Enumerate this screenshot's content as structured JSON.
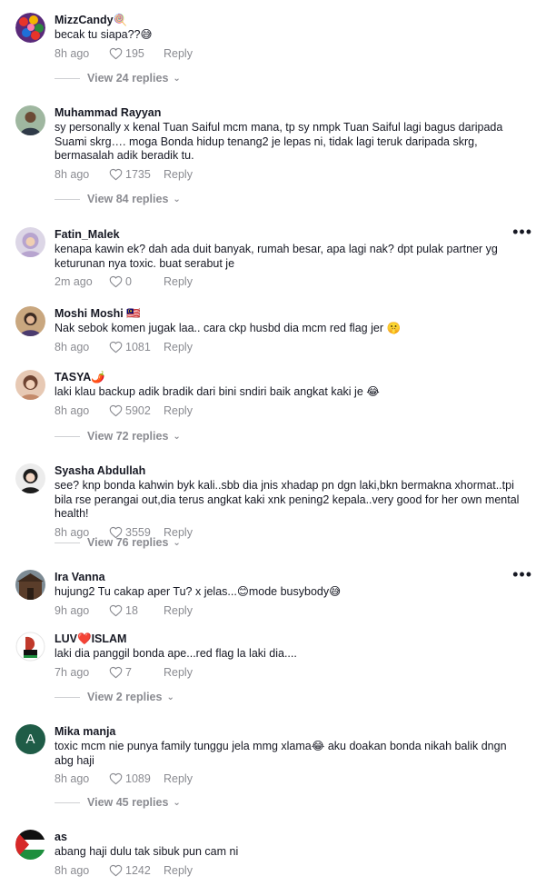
{
  "actions": {
    "view_prefix": "View",
    "view_suffix": "replies",
    "dots": "•••"
  },
  "comments": [
    {
      "username": "MizzCandy",
      "user_emoji": "🍭",
      "text": "becak tu siapa??😅",
      "time": "8h ago",
      "likes": "195",
      "reply": "Reply",
      "replies_label": "View 24 replies",
      "avatar": "candy-avatar"
    },
    {
      "username": "Muhammad Rayyan",
      "user_emoji": "",
      "text": "sy personally x kenal Tuan Saiful mcm mana, tp sy nmpk Tuan Saiful lagi bagus daripada Suami skrg…. moga Bonda hidup tenang2 je lepas ni, tidak lagi teruk daripada skrg, bermasalah adik beradik tu.",
      "time": "8h ago",
      "likes": "1735",
      "reply": "Reply",
      "replies_label": "View 84 replies",
      "avatar": "man-avatar"
    },
    {
      "username": "Fatin_Malek",
      "user_emoji": "",
      "text": "kenapa kawin ek? dah ada duit banyak, rumah besar, apa lagi nak? dpt pulak partner yg keturunan nya toxic. buat serabut je",
      "time": "2m ago",
      "likes": "0",
      "reply": "Reply",
      "replies_label": "",
      "avatar": "hijab-avatar"
    },
    {
      "username": "Moshi Moshi",
      "user_emoji": "🇲🇾",
      "text": "Nak sebok komen jugak laa.. cara ckp husbd dia mcm red flag jer 🤫",
      "time": "8h ago",
      "likes": "1081",
      "reply": "Reply",
      "replies_label": "",
      "avatar": "woman-avatar"
    },
    {
      "username": "TASYA",
      "user_emoji": "🌶️",
      "text": "laki klau backup adik bradik dari bini sndiri baik angkat kaki je 😂",
      "time": "8h ago",
      "likes": "5902",
      "reply": "Reply",
      "replies_label": "View 72 replies",
      "avatar": "tasya-avatar"
    },
    {
      "username": "Syasha Abdullah",
      "user_emoji": "",
      "text": "see? knp bonda kahwin byk kali..sbb dia jnis xhadap pn dgn laki,bkn bermakna xhormat..tpi bila rse perangai out,dia terus angkat kaki xnk pening2 kepala..very good for her own mental health!",
      "time": "8h ago",
      "likes": "3559",
      "reply": "Reply",
      "replies_label": "View 76 replies",
      "avatar": "syasha-avatar"
    },
    {
      "username": "Ira Vanna",
      "user_emoji": "",
      "text": "hujung2 Tu cakap aper Tu? x jelas...😊mode busybody😅",
      "time": "9h ago",
      "likes": "18",
      "reply": "Reply",
      "replies_label": "",
      "avatar": "building-avatar"
    },
    {
      "username": "LUV",
      "user_emoji": "❤️",
      "username_suffix": "ISLAM",
      "text": "laki dia panggil bonda ape...red flag la laki dia....",
      "time": "7h ago",
      "likes": "7",
      "reply": "Reply",
      "replies_label": "View 2 replies",
      "avatar": "islam-avatar"
    },
    {
      "username": "Mika manja",
      "user_emoji": "",
      "text": "toxic mcm nie punya family tunggu jela mmg xlama😂 aku doakan bonda nikah balik dngn abg haji",
      "time": "8h ago",
      "likes": "1089",
      "reply": "Reply",
      "replies_label": "View 45 replies",
      "avatar": "letter-avatar",
      "avatar_letter": "A"
    },
    {
      "username": "as",
      "user_emoji": "",
      "text": "abang haji dulu tak sibuk pun cam ni",
      "time": "8h ago",
      "likes": "1242",
      "reply": "Reply",
      "replies_label": "",
      "avatar": "flag-avatar"
    }
  ]
}
